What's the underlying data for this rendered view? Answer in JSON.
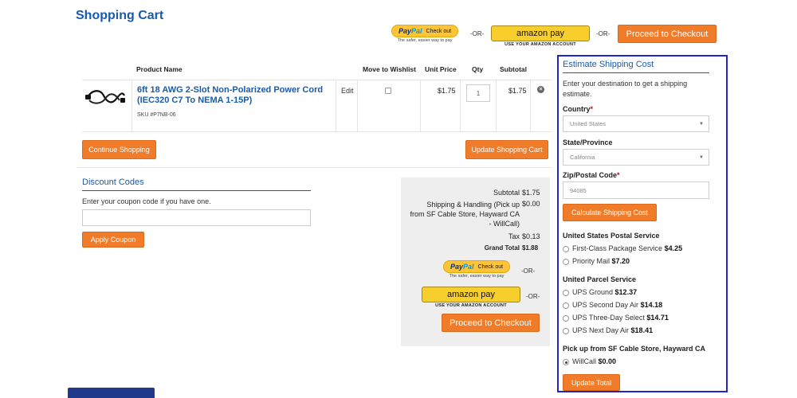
{
  "page_title": "Shopping Cart",
  "payment": {
    "paypal_brand_pay": "Pay",
    "paypal_brand_pal": "Pal",
    "paypal_checkout": "Check out",
    "paypal_tagline": "The safer, easier way to pay",
    "amazon_label": "amazon pay",
    "amazon_tagline": "USE YOUR AMAZON ACCOUNT",
    "or_text": "-OR-",
    "proceed_label": "Proceed to Checkout"
  },
  "cart": {
    "headers": {
      "product_name": "Product Name",
      "wishlist": "Move to Wishlist",
      "unit_price": "Unit Price",
      "qty": "Qty",
      "subtotal": "Subtotal"
    },
    "item": {
      "name_line1": "6ft 18 AWG 2-Slot Non-Polarized Power Cord",
      "name_line2": "(IEC320 C7 To NEMA 1-15P)",
      "sku": "SKU #P7NB-06",
      "edit": "Edit",
      "wishlist_checked": false,
      "unit_price": "$1.75",
      "qty": "1",
      "subtotal": "$1.75",
      "remove_icon": "remove-circle-icon"
    },
    "continue_label": "Continue Shopping",
    "update_label": "Update Shopping Cart"
  },
  "discount": {
    "title": "Discount Codes",
    "prompt": "Enter your coupon code if you have one.",
    "value": "",
    "apply_label": "Apply Coupon"
  },
  "totals": {
    "subtotal_label": "Subtotal",
    "subtotal_value": "$1.75",
    "shipping_label_1": "Shipping & Handling (Pick up",
    "shipping_label_2": "from SF Cable Store, Hayward CA",
    "shipping_label_3": "- WillCall)",
    "shipping_value": "$0.00",
    "tax_label": "Tax",
    "tax_value": "$0.13",
    "grand_label": "Grand Total",
    "grand_value": "$1.88"
  },
  "shipping": {
    "title": "Estimate Shipping Cost",
    "intro_1": "Enter your destination to get a shipping",
    "intro_2": "estimate.",
    "country_label": "Country",
    "country_value": "United States",
    "state_label": "State/Province",
    "state_value": "California",
    "zip_label": "Zip/Postal Code",
    "zip_value": "94085",
    "required_mark": "*",
    "calc_label": "Calculate Shipping Cost",
    "usps_title": "United States Postal Service",
    "usps_options": [
      {
        "name": "First-Class Package Service",
        "price": "$4.25"
      },
      {
        "name": "Priority Mail",
        "price": "$7.20"
      }
    ],
    "ups_title": "United Parcel Service",
    "ups_options": [
      {
        "name": "UPS Ground",
        "price": "$12.37"
      },
      {
        "name": "UPS Second Day Air",
        "price": "$14.18"
      },
      {
        "name": "UPS Three-Day Select",
        "price": "$14.71"
      },
      {
        "name": "UPS Next Day Air",
        "price": "$18.41"
      }
    ],
    "pickup_title": "Pick up from SF Cable Store, Hayward CA",
    "pickup_options": [
      {
        "name": "WillCall",
        "price": "$0.00",
        "selected": true
      }
    ],
    "update_total_label": "Update Total"
  },
  "colors": {
    "accent_orange": "#f07c2a",
    "link_blue": "#1a5ba6",
    "panel_border": "#1f25c7"
  }
}
